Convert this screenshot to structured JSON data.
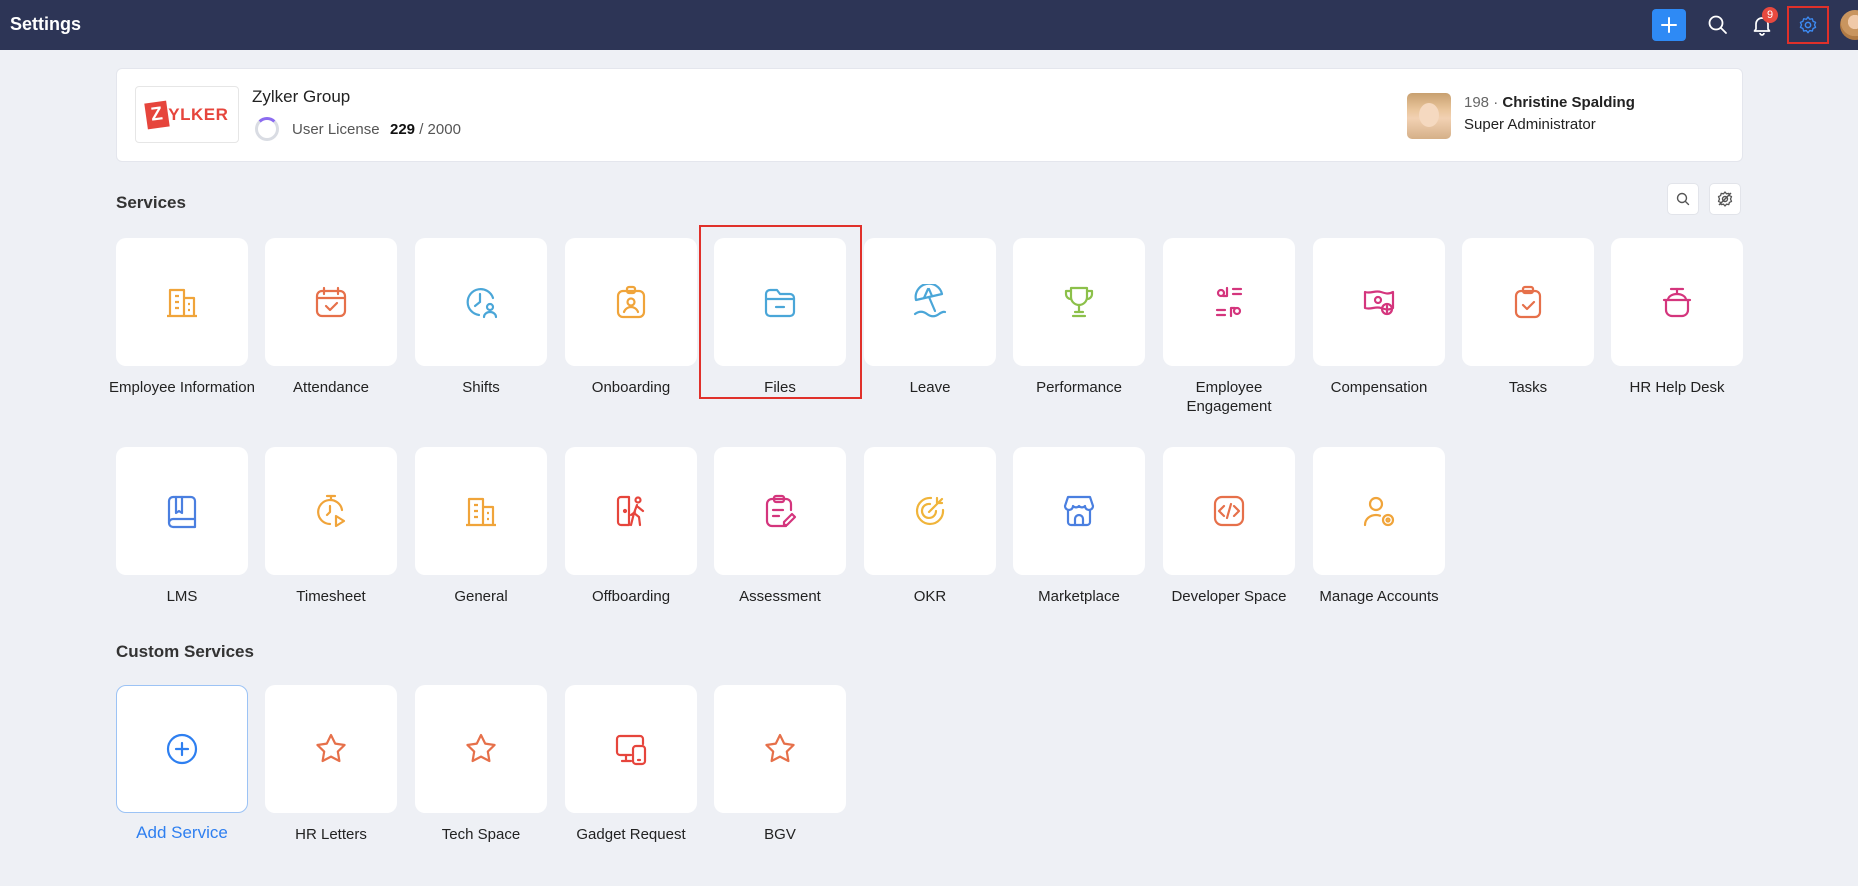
{
  "topbar": {
    "title": "Settings",
    "notification_count": "9"
  },
  "org": {
    "logo_initial": "Z",
    "logo_rest": "YLKER",
    "name": "Zylker Group",
    "license_label": "User License",
    "license_used": "229",
    "license_separator": " / ",
    "license_total": "2000"
  },
  "user": {
    "id": "198",
    "separator": " · ",
    "name": "Christine Spalding",
    "role": "Super Administrator"
  },
  "services": {
    "title": "Services",
    "row1": [
      {
        "label": "Employee Information",
        "icon": "building-icon",
        "color": "#f0a43a"
      },
      {
        "label": "Attendance",
        "icon": "calendar-check-icon",
        "color": "#e6704a"
      },
      {
        "label": "Shifts",
        "icon": "clock-user-icon",
        "color": "#4aa6d8"
      },
      {
        "label": "Onboarding",
        "icon": "id-badge-icon",
        "color": "#f0a43a"
      },
      {
        "label": "Files",
        "icon": "folder-icon",
        "color": "#4aa6d8"
      },
      {
        "label": "Leave",
        "icon": "beach-umbrella-icon",
        "color": "#4aa6d8"
      },
      {
        "label": "Performance",
        "icon": "trophy-icon",
        "color": "#8cc04a"
      },
      {
        "label": "Employee Engagement",
        "icon": "engagement-icon",
        "color": "#d4357d"
      },
      {
        "label": "Compensation",
        "icon": "money-icon",
        "color": "#d4357d"
      },
      {
        "label": "Tasks",
        "icon": "clipboard-check-icon",
        "color": "#e6704a"
      },
      {
        "label": "HR Help Desk",
        "icon": "help-desk-icon",
        "color": "#d4357d"
      }
    ],
    "row2": [
      {
        "label": "LMS",
        "icon": "book-icon",
        "color": "#4a7fe0"
      },
      {
        "label": "Timesheet",
        "icon": "timer-play-icon",
        "color": "#f0a43a"
      },
      {
        "label": "General",
        "icon": "building-icon",
        "color": "#f0a43a"
      },
      {
        "label": "Offboarding",
        "icon": "exit-door-icon",
        "color": "#e6453c"
      },
      {
        "label": "Assessment",
        "icon": "clipboard-edit-icon",
        "color": "#d4357d"
      },
      {
        "label": "OKR",
        "icon": "target-icon",
        "color": "#f0b43a"
      },
      {
        "label": "Marketplace",
        "icon": "store-icon",
        "color": "#4a7fe0"
      },
      {
        "label": "Developer Space",
        "icon": "code-icon",
        "color": "#e6704a"
      },
      {
        "label": "Manage Accounts",
        "icon": "user-gear-icon",
        "color": "#f0a43a"
      }
    ]
  },
  "custom_services": {
    "title": "Custom Services",
    "add_label": "Add Service",
    "items": [
      {
        "label": "HR Letters",
        "icon": "star-icon",
        "color": "#e6704a"
      },
      {
        "label": "Tech Space",
        "icon": "star-icon",
        "color": "#e6704a"
      },
      {
        "label": "Gadget Request",
        "icon": "devices-icon",
        "color": "#e6453c"
      },
      {
        "label": "BGV",
        "icon": "star-icon",
        "color": "#e6704a"
      }
    ]
  }
}
